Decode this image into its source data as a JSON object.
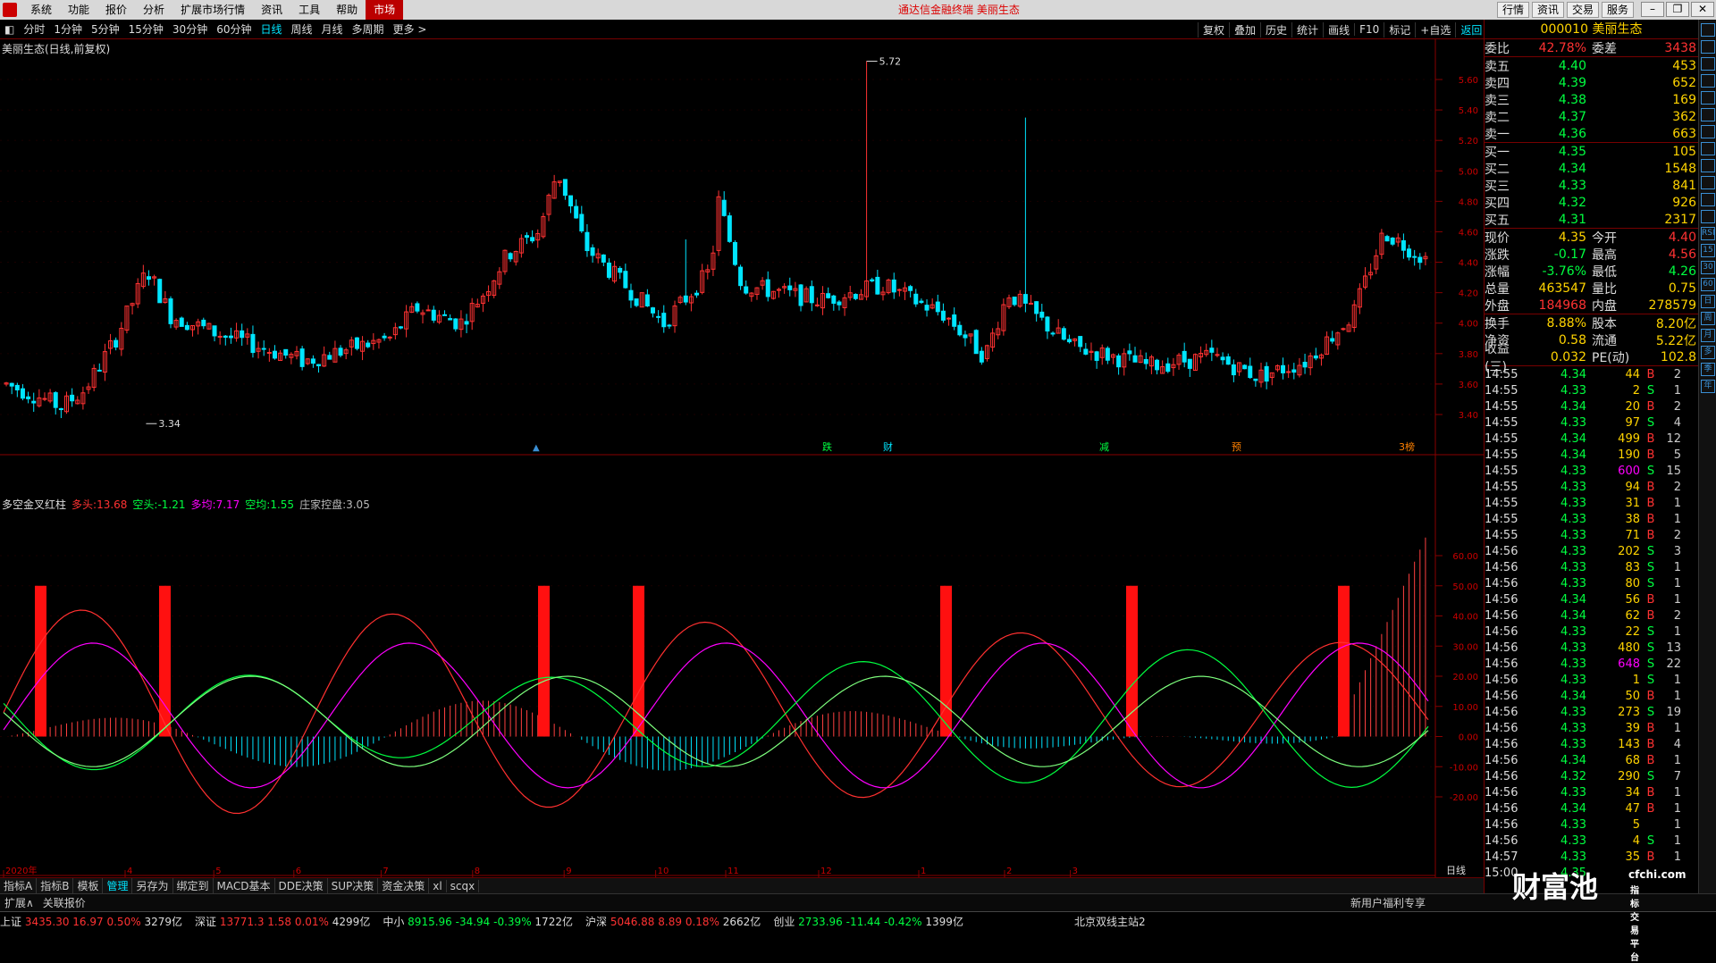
{
  "menubar": {
    "items": [
      "系统",
      "功能",
      "报价",
      "分析",
      "扩展市场行情",
      "资讯",
      "工具",
      "帮助",
      "市场"
    ],
    "center": "通达信金融终端  美丽生态",
    "right": [
      "行情",
      "资讯",
      "交易",
      "服务"
    ]
  },
  "periods": [
    "分时",
    "1分钟",
    "5分钟",
    "15分钟",
    "30分钟",
    "60分钟",
    "日线",
    "周线",
    "月线",
    "多周期",
    "更多 >"
  ],
  "active_period": "日线",
  "toolbar2": [
    "复权",
    "叠加",
    "历史",
    "统计",
    "画线",
    "F10",
    "标记",
    "+自选",
    "返回"
  ],
  "chart_title": "美丽生态(日线,前复权)",
  "price_axis": [
    "5.60",
    "5.40",
    "5.20",
    "5.00",
    "4.80",
    "4.60",
    "4.40",
    "4.20",
    "4.00",
    "3.80",
    "3.60",
    "3.40"
  ],
  "max_label": "5.72",
  "min_label": "3.34",
  "event_tags": [
    "跌",
    "财",
    "减",
    "预",
    "3榜"
  ],
  "indicator": {
    "name": "多空金叉红柱",
    "duo_label": "多头:",
    "duo": "13.68",
    "kong_label": "空头:",
    "kong": "-1.21",
    "duojun_label": "多均:",
    "duojun": "7.17",
    "kongjun_label": "空均:",
    "kongjun": "1.55",
    "zhuang_label": "庄家控盘:",
    "zhuang": "3.05"
  },
  "ind_axis": [
    "60.00",
    "50.00",
    "40.00",
    "30.00",
    "20.00",
    "10.00",
    "0.00",
    "-10.00",
    "-20.00"
  ],
  "date_axis": [
    "2020年",
    "4",
    "5",
    "6",
    "7",
    "8",
    "9",
    "10",
    "11",
    "12",
    "1",
    "2",
    "3"
  ],
  "date_axis_label": "日线",
  "bottom_tabs": [
    "指标A",
    "指标B",
    "模板",
    "管理",
    "另存为",
    "绑定到",
    "MACD基本",
    "DDE决策",
    "SUP决策",
    "资金决策",
    "xl",
    "scqx"
  ],
  "ext": [
    "扩展∧",
    "关联报价"
  ],
  "ext_right": [
    "新用户福利专享",
    "笔"
  ],
  "quote": {
    "code": "000010",
    "name": "美丽生态",
    "weibi": "42.78%",
    "weicha": "3438",
    "sells": [
      [
        "卖五",
        "4.40",
        "453"
      ],
      [
        "卖四",
        "4.39",
        "652"
      ],
      [
        "卖三",
        "4.38",
        "169"
      ],
      [
        "卖二",
        "4.37",
        "362"
      ],
      [
        "卖一",
        "4.36",
        "663"
      ]
    ],
    "buys": [
      [
        "买一",
        "4.35",
        "105"
      ],
      [
        "买二",
        "4.34",
        "1548"
      ],
      [
        "买三",
        "4.33",
        "841"
      ],
      [
        "买四",
        "4.32",
        "926"
      ],
      [
        "买五",
        "4.31",
        "2317"
      ]
    ],
    "stats": [
      [
        "现价",
        "4.35",
        "今开",
        "4.40"
      ],
      [
        "涨跌",
        "-0.17",
        "最高",
        "4.56"
      ],
      [
        "涨幅",
        "-3.76%",
        "最低",
        "4.26"
      ],
      [
        "总量",
        "463547",
        "量比",
        "0.75"
      ],
      [
        "外盘",
        "184968",
        "内盘",
        "278579"
      ]
    ],
    "stats2": [
      [
        "换手",
        "8.88%",
        "股本",
        "8.20亿"
      ],
      [
        "净资",
        "0.58",
        "流通",
        "5.22亿"
      ],
      [
        "收益(三)",
        "0.032",
        "PE(动)",
        "102.8"
      ]
    ],
    "ticks": [
      [
        "14:55",
        "4.34",
        "44",
        "B",
        "2"
      ],
      [
        "14:55",
        "4.33",
        "2",
        "S",
        "1"
      ],
      [
        "14:55",
        "4.34",
        "20",
        "B",
        "2"
      ],
      [
        "14:55",
        "4.33",
        "97",
        "S",
        "4"
      ],
      [
        "14:55",
        "4.34",
        "499",
        "B",
        "12"
      ],
      [
        "14:55",
        "4.34",
        "190",
        "B",
        "5"
      ],
      [
        "14:55",
        "4.33",
        "600",
        "S",
        "15"
      ],
      [
        "14:55",
        "4.33",
        "94",
        "B",
        "2"
      ],
      [
        "14:55",
        "4.33",
        "31",
        "B",
        "1"
      ],
      [
        "14:55",
        "4.33",
        "38",
        "B",
        "1"
      ],
      [
        "14:55",
        "4.33",
        "71",
        "B",
        "2"
      ],
      [
        "14:56",
        "4.33",
        "202",
        "S",
        "3"
      ],
      [
        "14:56",
        "4.33",
        "83",
        "S",
        "1"
      ],
      [
        "14:56",
        "4.33",
        "80",
        "S",
        "1"
      ],
      [
        "14:56",
        "4.34",
        "56",
        "B",
        "1"
      ],
      [
        "14:56",
        "4.34",
        "62",
        "B",
        "2"
      ],
      [
        "14:56",
        "4.33",
        "22",
        "S",
        "1"
      ],
      [
        "14:56",
        "4.33",
        "480",
        "S",
        "13"
      ],
      [
        "14:56",
        "4.33",
        "648",
        "S",
        "22"
      ],
      [
        "14:56",
        "4.33",
        "1",
        "S",
        "1"
      ],
      [
        "14:56",
        "4.34",
        "50",
        "B",
        "1"
      ],
      [
        "14:56",
        "4.33",
        "273",
        "S",
        "19"
      ],
      [
        "14:56",
        "4.33",
        "39",
        "B",
        "1"
      ],
      [
        "14:56",
        "4.33",
        "143",
        "B",
        "4"
      ],
      [
        "14:56",
        "4.34",
        "68",
        "B",
        "1"
      ],
      [
        "14:56",
        "4.32",
        "290",
        "S",
        "7"
      ],
      [
        "14:56",
        "4.33",
        "34",
        "B",
        "1"
      ],
      [
        "14:56",
        "4.34",
        "47",
        "B",
        "1"
      ],
      [
        "14:56",
        "4.33",
        "5",
        "",
        "1"
      ],
      [
        "14:56",
        "4.33",
        "4",
        "S",
        "1"
      ],
      [
        "14:57",
        "4.33",
        "35",
        "B",
        "1"
      ],
      [
        "15:00",
        "4.35",
        "",
        "",
        " "
      ]
    ]
  },
  "sidebar": [
    "RSI",
    "15",
    "30",
    "60",
    "日",
    "周",
    "月",
    "多",
    "季",
    "年"
  ],
  "ticker": [
    [
      "上证",
      "3435.30",
      "16.97",
      "0.50%",
      "3279亿"
    ],
    [
      "深证",
      "13771.3",
      "1.58",
      "0.01%",
      "4299亿"
    ],
    [
      "中小",
      "8915.96",
      "-34.94",
      "-0.39%",
      "1722亿"
    ],
    [
      "沪深",
      "5046.88",
      "8.89",
      "0.18%",
      "2662亿"
    ],
    [
      "创业",
      "2733.96",
      "-11.44",
      "-0.42%",
      "1399亿"
    ]
  ],
  "server": "北京双线主站2",
  "watermark": "财富池",
  "watermark_url": "cfchi.com",
  "watermark_sub": "指标交易平台",
  "colors": {
    "up": "#ff3232",
    "down": "#00e5ff",
    "bg": "#000000",
    "accent": "#ffd400"
  }
}
